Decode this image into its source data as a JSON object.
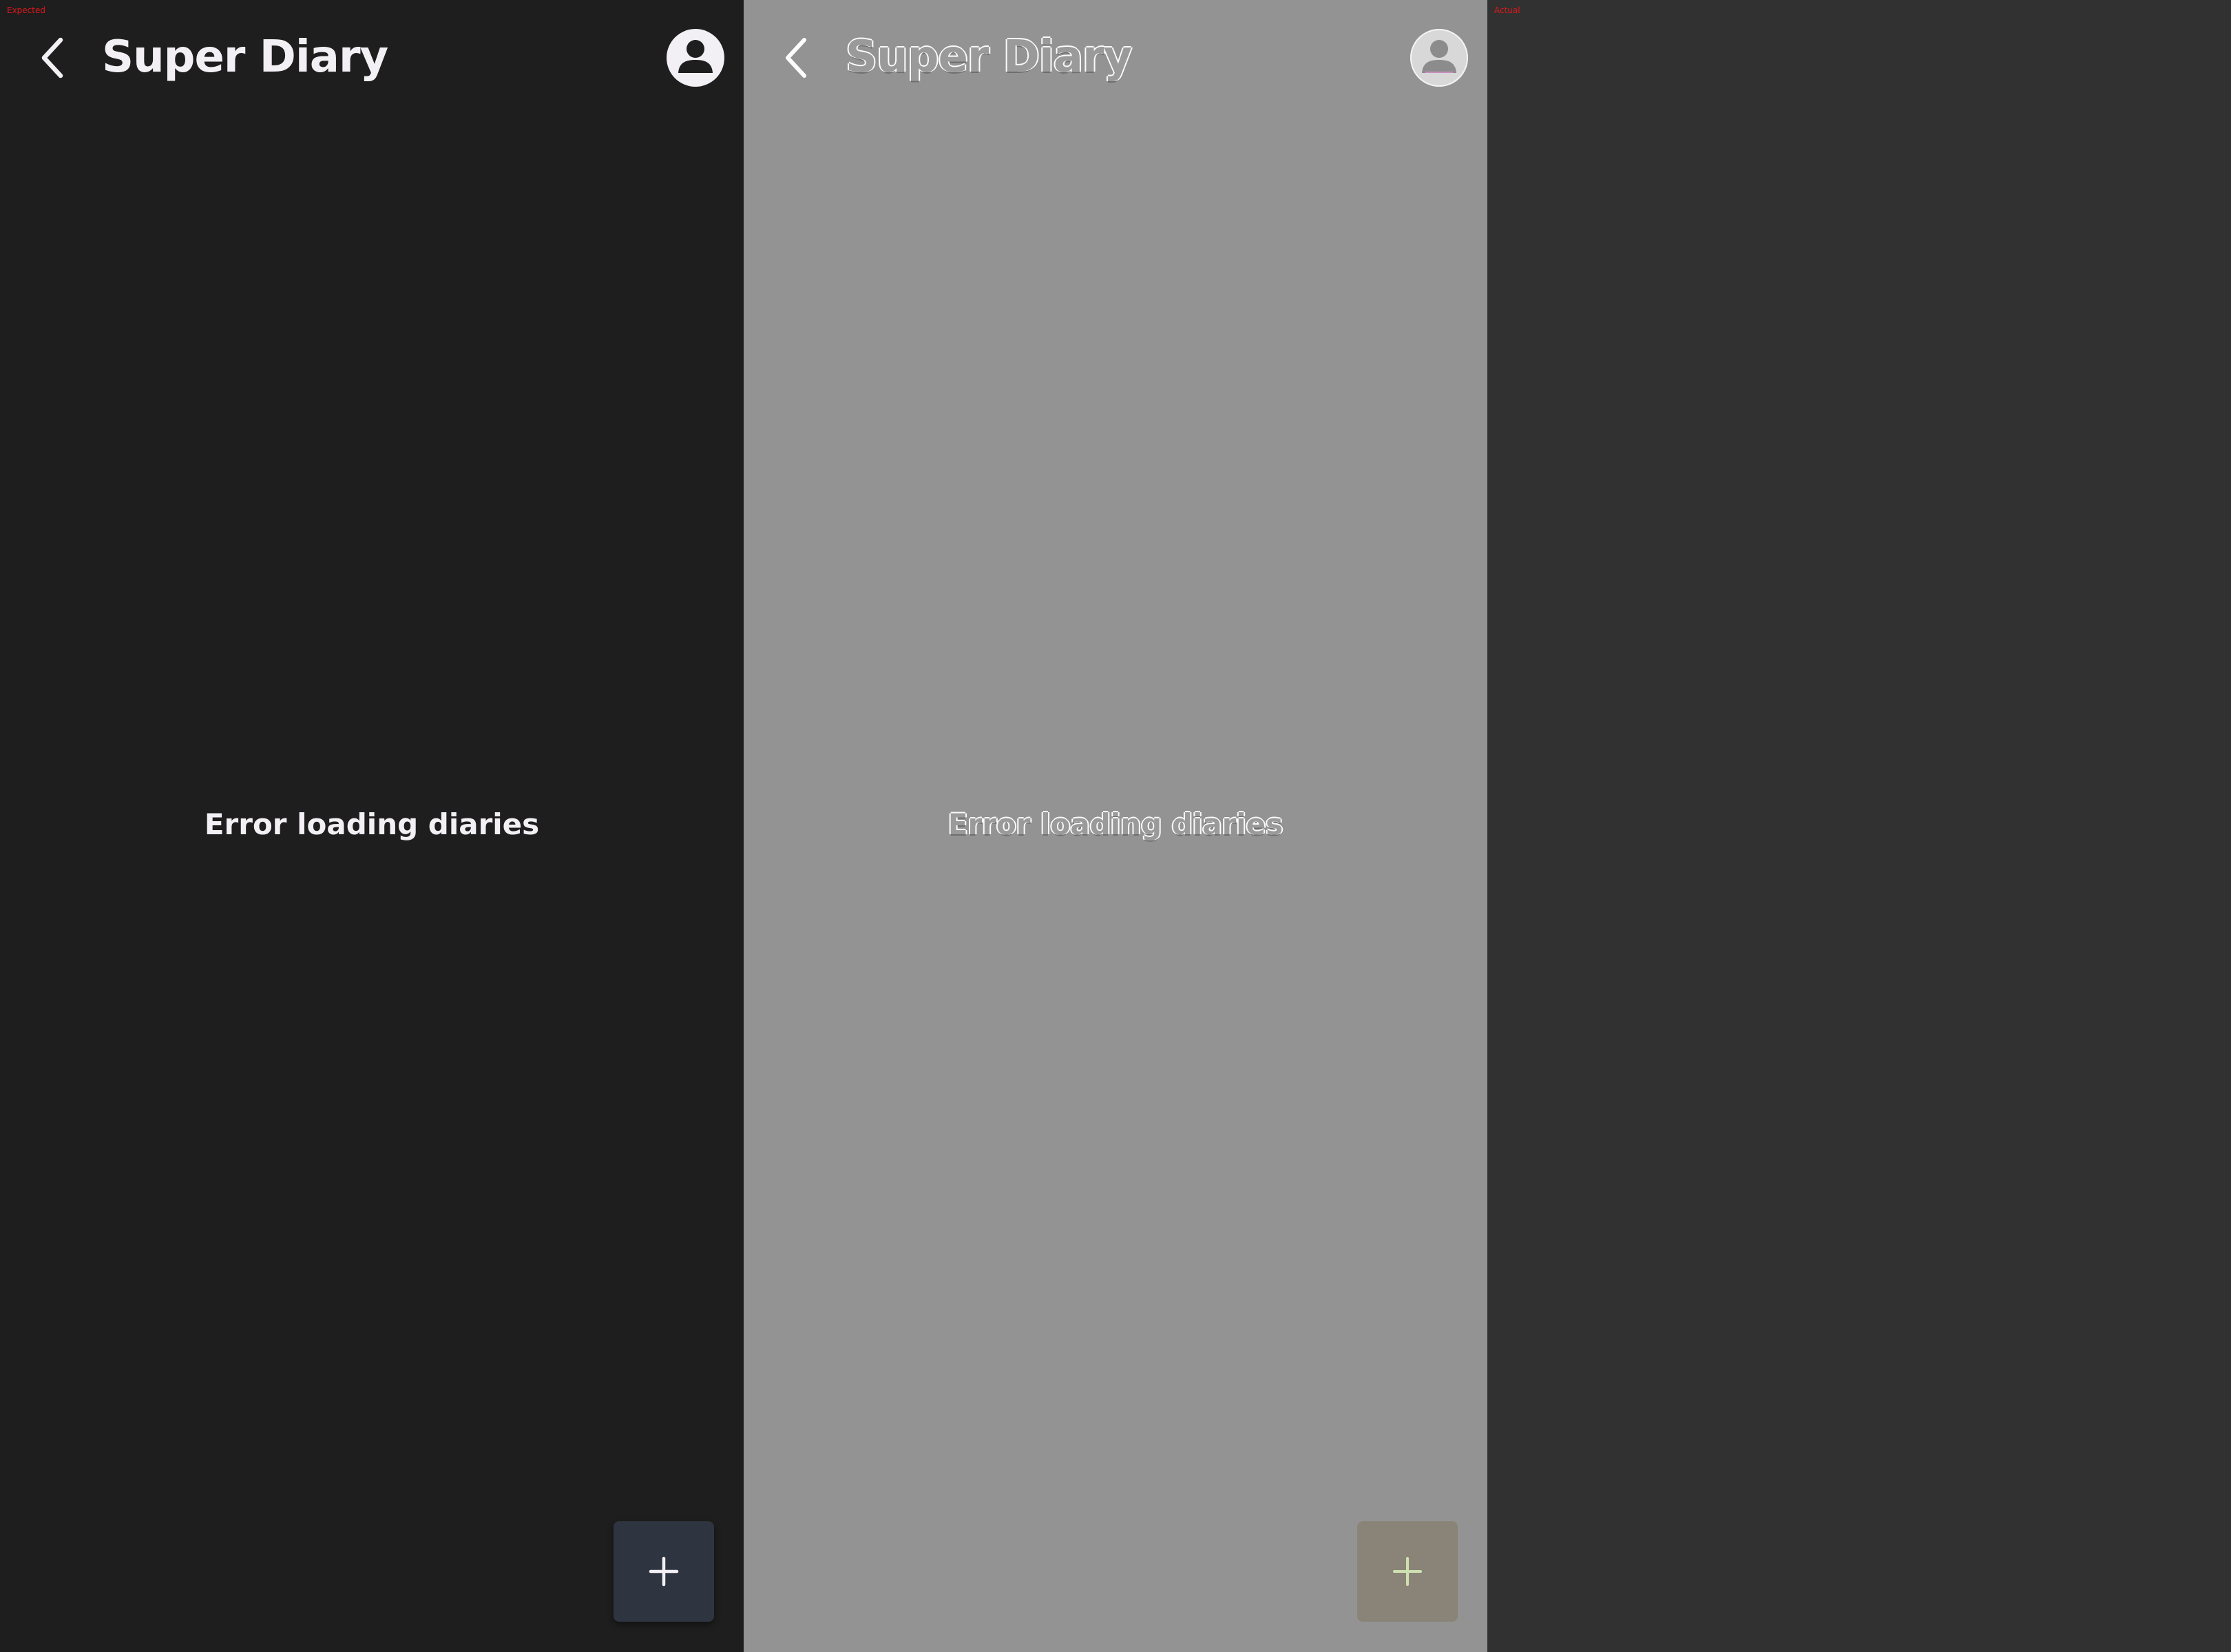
{
  "labels": {
    "expected": "Expected",
    "actual": "Actual"
  },
  "app": {
    "title": "Super Diary",
    "empty_message": "Error loading diaries"
  },
  "icons": {
    "back": "chevron-left-icon",
    "account": "account-circle-icon",
    "add": "plus-icon"
  },
  "colors": {
    "expected_background": "#1e1e1e",
    "diff_background": "#939393",
    "actual_background": "#313131",
    "text": "#f2f0f4",
    "fab_background": "#2f3540",
    "diff_fab_background": "#8a8478",
    "corner_label": "#e0171b"
  }
}
